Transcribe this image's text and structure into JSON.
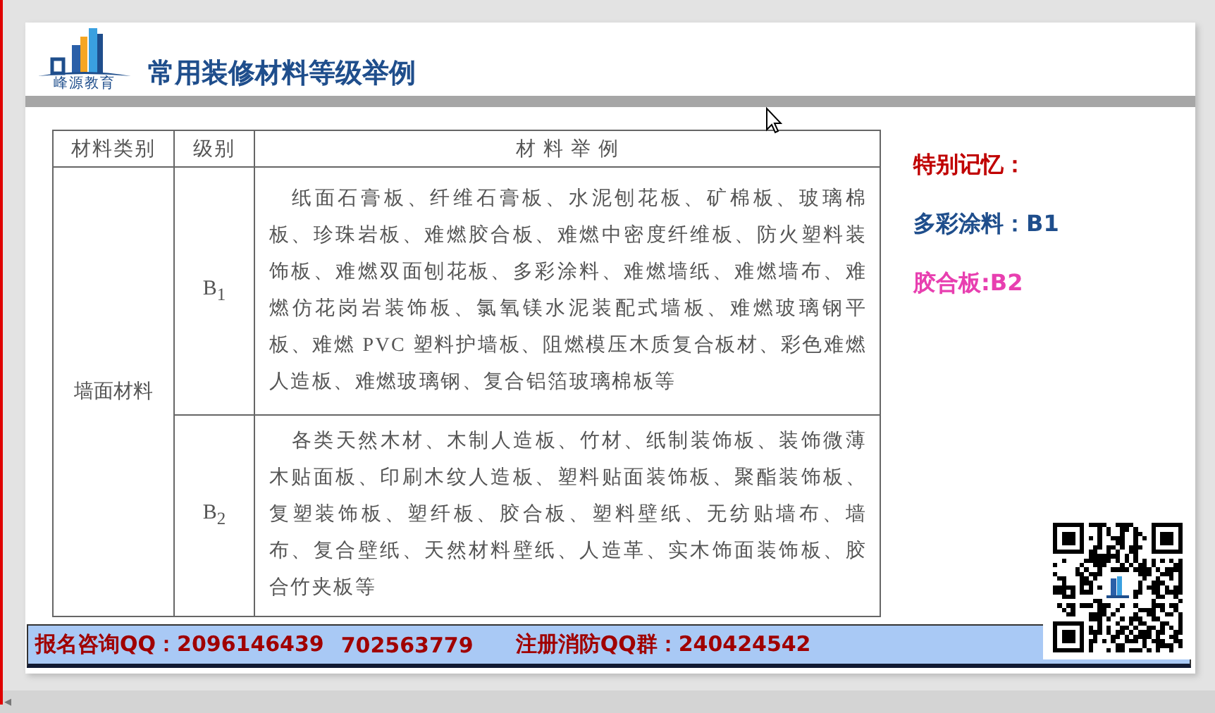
{
  "slide": {
    "logo_caption": "峰源教育",
    "title": "常用装修材料等级举例"
  },
  "table": {
    "columns": [
      "材料类别",
      "级别",
      "材 料 举 例"
    ],
    "rows": [
      {
        "category": "墙面材料",
        "grades": [
          {
            "grade": "B$_{1}$",
            "examples": "纸面石膏板、纤维石膏板、水泥刨花板、矿棉板、玻璃棉板、珍珠岩板、难燃胶合板、难燃中密度纤维板、防火塑料装饰板、难燃双面刨花板、多彩涂料、难燃墙纸、难燃墙布、难燃仿花岗岩装饰板、氯氧镁水泥装配式墙板、难燃玻璃钢平板、难燃 PVC 塑料护墙板、阻燃模压木质复合板材、彩色难燃人造板、难燃玻璃钢、复合铝箔玻璃棉板等"
          },
          {
            "grade": "B$_{2}$",
            "examples": "各类天然木材、木制人造板、竹材、纸制装饰板、装饰微薄木贴面板、印刷木纹人造板、塑料贴面装饰板、聚酯装饰板、复塑装饰板、塑纤板、胶合板、塑料壁纸、无纺贴墙布、墙布、复合壁纸、天然材料壁纸、人造革、实木饰面装饰板、胶合竹夹板等"
          }
        ]
      }
    ]
  },
  "notes": [
    {
      "text": "特别记忆：",
      "color": "#c00000"
    },
    {
      "text": "多彩涂料：B1",
      "color": "#1f4e8c"
    },
    {
      "text": "胶合板:B2",
      "color": "#e83fb0"
    }
  ],
  "footer": [
    "报名咨询QQ：2096146439",
    "702563779",
    "注册消防QQ群：240424542"
  ],
  "scrollbar": {
    "left_arrow": "◂"
  }
}
